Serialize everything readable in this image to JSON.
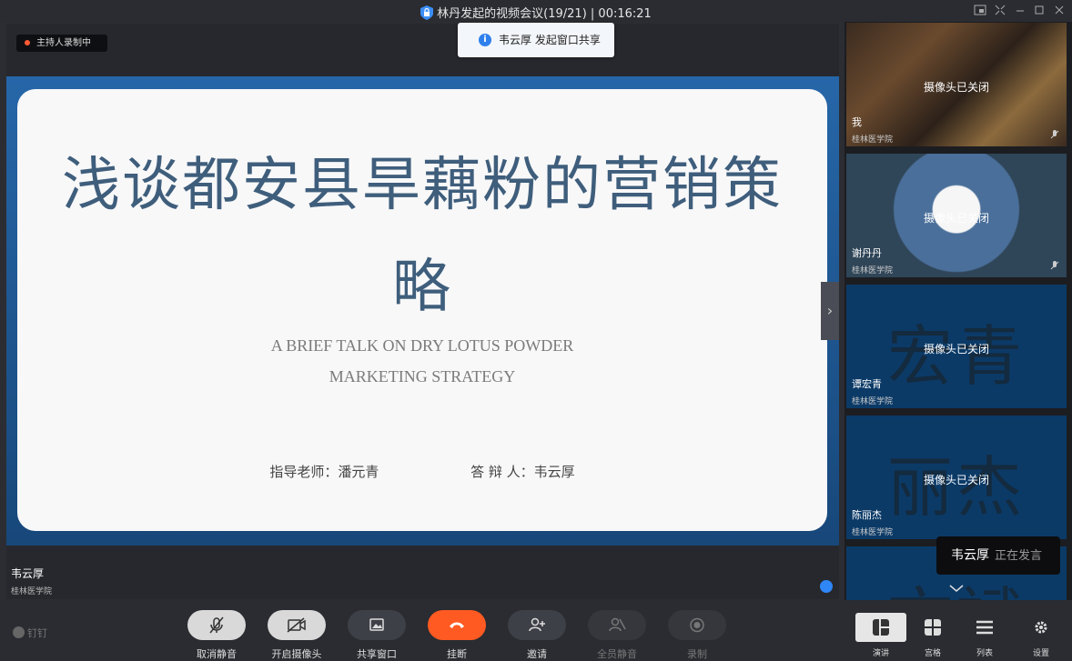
{
  "window": {
    "title": "林丹发起的视频会议(19/21)  |  00:16:21",
    "icons": [
      "lock-icon",
      "picture-in-picture-icon",
      "shrink-icon",
      "minimize-icon",
      "maximize-icon",
      "close-icon"
    ]
  },
  "recording_badge": "主持人录制中",
  "toast": {
    "text": "韦云厚 发起窗口共享",
    "icon": "info-icon"
  },
  "slide": {
    "title": "浅谈都安县旱藕粉的营销策略",
    "subtitle_line1": "A BRIEF TALK ON DRY LOTUS POWDER",
    "subtitle_line2": "MARKETING STRATEGY",
    "advisor": "指导老师：潘元青",
    "defender": "答 辩 人：韦云厚"
  },
  "stage": {
    "speaker_name": "韦云厚",
    "speaker_org": "桂林医学院"
  },
  "participants": [
    {
      "name": "我",
      "org": "桂林医学院",
      "status": "摄像头已关闭",
      "big": ""
    },
    {
      "name": "谢丹丹",
      "org": "桂林医学院",
      "status": "摄像头已关闭",
      "big": ""
    },
    {
      "name": "谭宏青",
      "org": "桂林医学院",
      "status": "摄像头已关闭",
      "big": "宏青"
    },
    {
      "name": "陈丽杰",
      "org": "桂林医学院",
      "status": "摄像头已关闭",
      "big": "丽杰"
    },
    {
      "name": "",
      "org": "",
      "status": "",
      "big": "文斌"
    }
  ],
  "speaking_popup": {
    "name": "韦云厚",
    "state": "正在发言"
  },
  "toolbar": {
    "brand": "钉钉",
    "buttons": [
      {
        "label": "取消静音",
        "icon": "mic-muted-icon"
      },
      {
        "label": "开启摄像头",
        "icon": "camera-off-icon"
      },
      {
        "label": "共享窗口",
        "icon": "share-window-icon"
      },
      {
        "label": "挂断",
        "icon": "hang-up-icon"
      },
      {
        "label": "邀请",
        "icon": "invite-icon"
      },
      {
        "label": "全员静音",
        "icon": "mute-all-icon"
      },
      {
        "label": "录制",
        "icon": "record-icon"
      }
    ],
    "views": [
      {
        "label": "演讲",
        "icon": "speaker-view-icon",
        "active": true
      },
      {
        "label": "宫格",
        "icon": "grid-view-icon",
        "active": false
      },
      {
        "label": "列表",
        "icon": "list-view-icon",
        "active": false
      }
    ],
    "settings_label": "设置"
  },
  "colors": {
    "hangup": "#ff5a22",
    "slide_title": "#3f5e7c",
    "accent_blue": "#2f80ed",
    "tile_blue": "#0b3a67"
  }
}
